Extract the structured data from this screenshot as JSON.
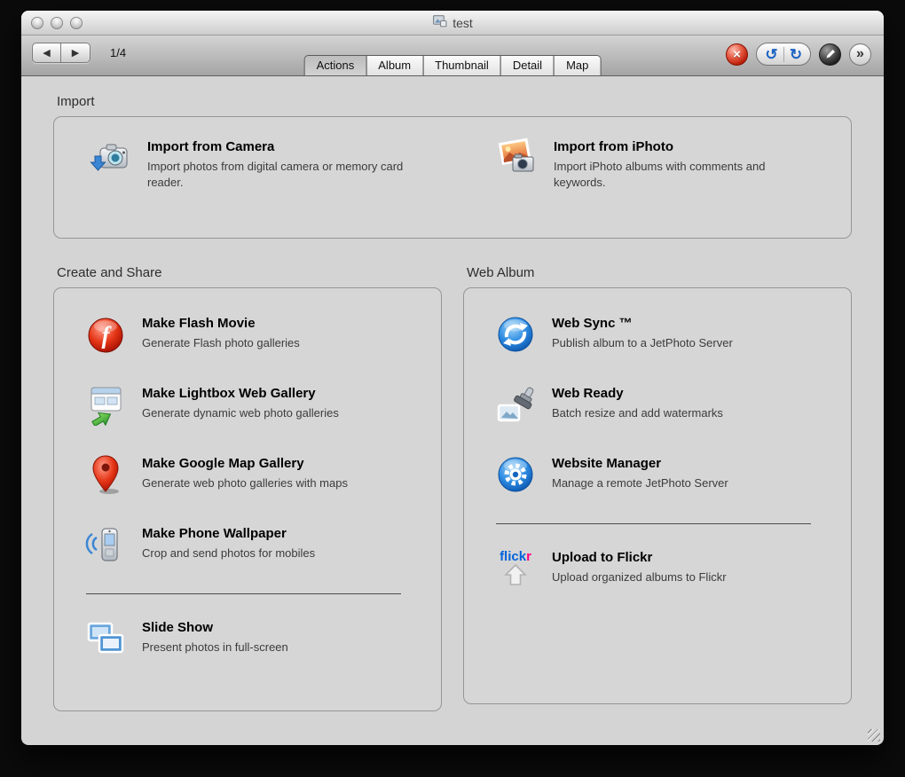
{
  "window": {
    "title": "test"
  },
  "toolbar": {
    "page_indicator": "1/4",
    "icons": {
      "back": "◀",
      "forward": "▶",
      "close": "×",
      "undo": "↺",
      "redo": "↻",
      "more": "»"
    },
    "tabs": [
      "Actions",
      "Album",
      "Thumbnail",
      "Detail",
      "Map"
    ],
    "active_tab": "Actions"
  },
  "sections": {
    "import": {
      "label": "Import",
      "items": [
        {
          "title": "Import from Camera",
          "subtitle": "Import photos from digital camera or memory card reader."
        },
        {
          "title": "Import from iPhoto",
          "subtitle": "Import iPhoto albums with comments and keywords."
        }
      ]
    },
    "create_share": {
      "label": "Create and Share",
      "items": [
        {
          "title": "Make Flash Movie",
          "subtitle": "Generate Flash photo galleries"
        },
        {
          "title": "Make Lightbox Web Gallery",
          "subtitle": "Generate dynamic web photo galleries"
        },
        {
          "title": "Make Google Map Gallery",
          "subtitle": "Generate web photo galleries with maps"
        },
        {
          "title": "Make Phone Wallpaper",
          "subtitle": "Crop and send photos for mobiles"
        },
        {
          "title": "Slide Show",
          "subtitle": "Present photos in full-screen"
        }
      ]
    },
    "web_album": {
      "label": "Web Album",
      "items": [
        {
          "title": "Web Sync ™",
          "subtitle": "Publish album to a JetPhoto Server"
        },
        {
          "title": "Web Ready",
          "subtitle": "Batch resize and add watermarks"
        },
        {
          "title": "Website Manager",
          "subtitle": "Manage a remote JetPhoto Server"
        },
        {
          "title": "Upload to Flickr",
          "subtitle": "Upload organized albums to Flickr"
        }
      ]
    }
  },
  "colors": {
    "flash_red": "#cc1a00",
    "jetphoto_blue": "#1465c0",
    "flickr_blue": "#0063dc",
    "flickr_pink": "#ff0084"
  }
}
